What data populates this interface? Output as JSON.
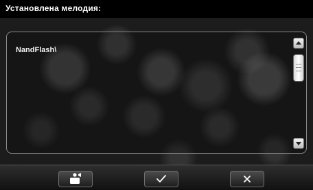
{
  "title": "Установлена мелодия:",
  "list": {
    "items": [
      "NandFlash\\"
    ]
  },
  "scrollbar": {
    "up_icon": "arrow-up-icon",
    "down_icon": "arrow-down-icon"
  },
  "toolbar": {
    "buttons": [
      {
        "id": "media",
        "icon": "media-player-icon"
      },
      {
        "id": "ok",
        "icon": "checkmark-icon"
      },
      {
        "id": "cancel",
        "icon": "close-icon"
      }
    ]
  },
  "colors": {
    "title_bar": "#000000",
    "text": "#ffffff",
    "panel_border": "#8a8a8a"
  }
}
